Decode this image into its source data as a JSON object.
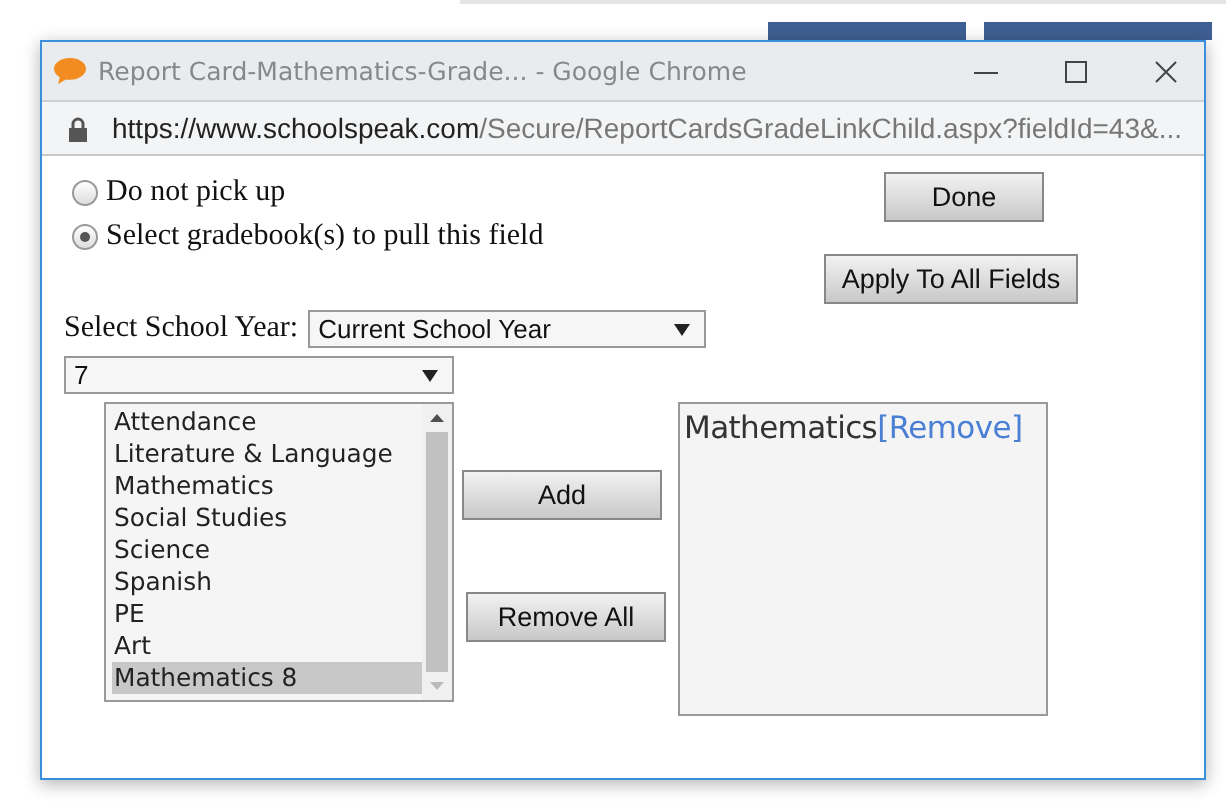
{
  "background_buttons": [
    {
      "kind": "partial"
    },
    {
      "kind": "partial"
    }
  ],
  "window": {
    "title": "Report Card-Mathematics-Grade... - Google Chrome",
    "url_host": "https://www.schoolspeak.com",
    "url_path": "/Secure/ReportCardsGradeLinkChild.aspx?fieldId=43&..."
  },
  "options": [
    {
      "label": "Do not pick up",
      "selected": false
    },
    {
      "label": "Select gradebook(s) to pull this field",
      "selected": true
    }
  ],
  "done_button": "Done",
  "apply_button": "Apply To All Fields",
  "school_year": {
    "label": "Select School Year:",
    "value": "Current School Year"
  },
  "grade": {
    "value": "7"
  },
  "gradebooks": [
    {
      "label": "Attendance",
      "selected": false
    },
    {
      "label": "Literature & Language",
      "selected": false
    },
    {
      "label": "Mathematics",
      "selected": false
    },
    {
      "label": "Social Studies",
      "selected": false
    },
    {
      "label": "Science",
      "selected": false
    },
    {
      "label": "Spanish",
      "selected": false
    },
    {
      "label": "PE",
      "selected": false
    },
    {
      "label": "Art",
      "selected": false
    },
    {
      "label": "Mathematics 8",
      "selected": true
    }
  ],
  "add_button": "Add",
  "remove_all_button": "Remove All",
  "chosen": [
    {
      "name": "Mathematics",
      "action": "[Remove]"
    }
  ]
}
